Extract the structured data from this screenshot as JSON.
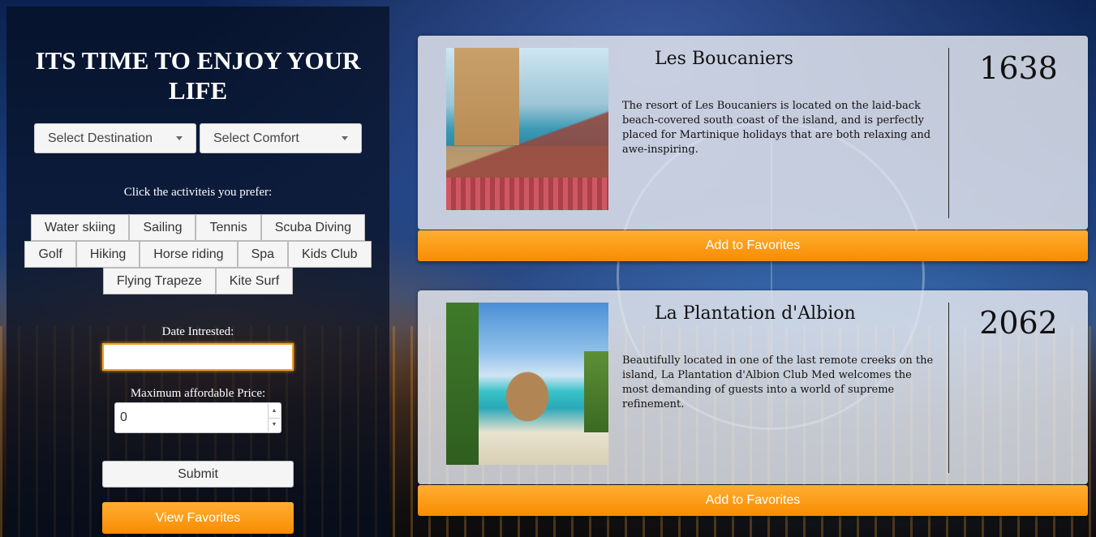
{
  "sidebar": {
    "title": "ITS TIME TO ENJOY YOUR LIFE",
    "destination_select": "Select Destination",
    "comfort_select": "Select Comfort",
    "activities_label": "Click the activiteis you prefer:",
    "activities": [
      [
        "Water skiing",
        "Sailing",
        "Tennis",
        "Scuba Diving"
      ],
      [
        "Golf",
        "Hiking",
        "Horse riding",
        "Spa",
        "Kids Club"
      ],
      [
        "Flying Trapeze",
        "Kite Surf"
      ]
    ],
    "date_label": "Date Intrested:",
    "date_value": "",
    "price_label": "Maximum affordable Price:",
    "price_value": "0",
    "submit_label": "Submit",
    "view_favorites_label": "View Favorites"
  },
  "resorts": [
    {
      "name": "Les Boucaniers",
      "description": "The resort of Les Boucaniers is located on the laid-back beach-covered south coast of the island, and is perfectly placed for Martinique holidays that are both relaxing and awe-inspiring.",
      "price": "1638",
      "button_label": "Add to Favorites"
    },
    {
      "name": "La Plantation d'Albion",
      "description": "Beautifully located in one of the last remote creeks on the island, La Plantation d'Albion Club Med welcomes the most demanding of guests into a world of supreme refinement.",
      "price": "2062",
      "button_label": "Add to Favorites"
    }
  ],
  "colors": {
    "accent": "#f88c00",
    "panel": "#060e20"
  }
}
